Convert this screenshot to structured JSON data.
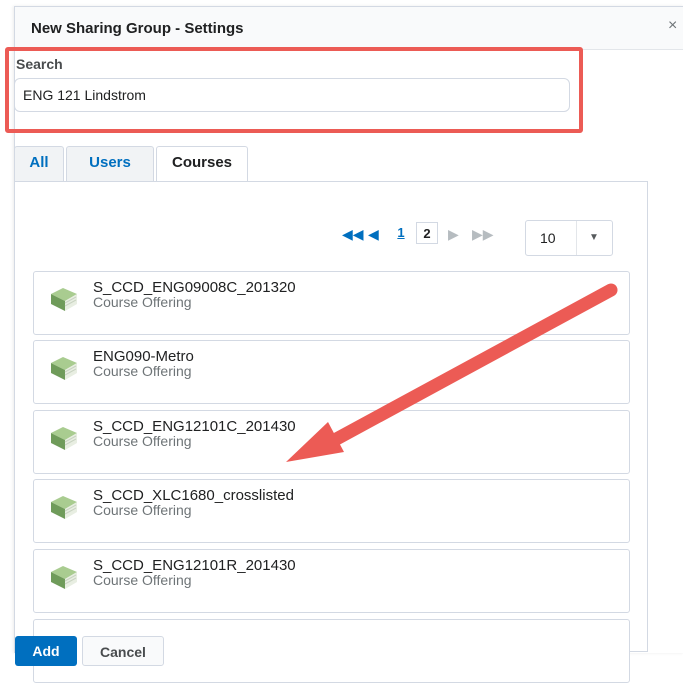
{
  "dialog": {
    "title": "New Sharing Group - Settings",
    "close_glyph": "×"
  },
  "search": {
    "label": "Search",
    "value": "ENG 121 Lindstrom"
  },
  "tabs": [
    {
      "label": "All",
      "active": false
    },
    {
      "label": "Users",
      "active": false
    },
    {
      "label": "Courses",
      "active": true
    }
  ],
  "pagination": {
    "pages": [
      "1",
      "2"
    ],
    "current_page": "2",
    "per_page": "10",
    "first_icon": "first-page-icon",
    "prev_icon": "prev-page-icon",
    "next_icon": "next-page-icon",
    "last_icon": "last-page-icon"
  },
  "courses": [
    {
      "name": "S_CCD_ENG09008C_201320",
      "type": "Course Offering",
      "icon": "book-icon"
    },
    {
      "name": "ENG090-Metro",
      "type": "Course Offering",
      "icon": "book-icon"
    },
    {
      "name": "S_CCD_ENG12101C_201430",
      "type": "Course Offering",
      "icon": "book-icon"
    },
    {
      "name": "S_CCD_XLC1680_crosslisted",
      "type": "Course Offering",
      "icon": "book-icon"
    },
    {
      "name": "S_CCD_ENG12101R_201430",
      "type": "Course Offering",
      "icon": "book-icon"
    }
  ],
  "buttons": {
    "add": "Add",
    "cancel": "Cancel"
  },
  "colors": {
    "accent": "#006fbf",
    "annotation": "#ec5b55",
    "book_green": "#7ea86a"
  }
}
